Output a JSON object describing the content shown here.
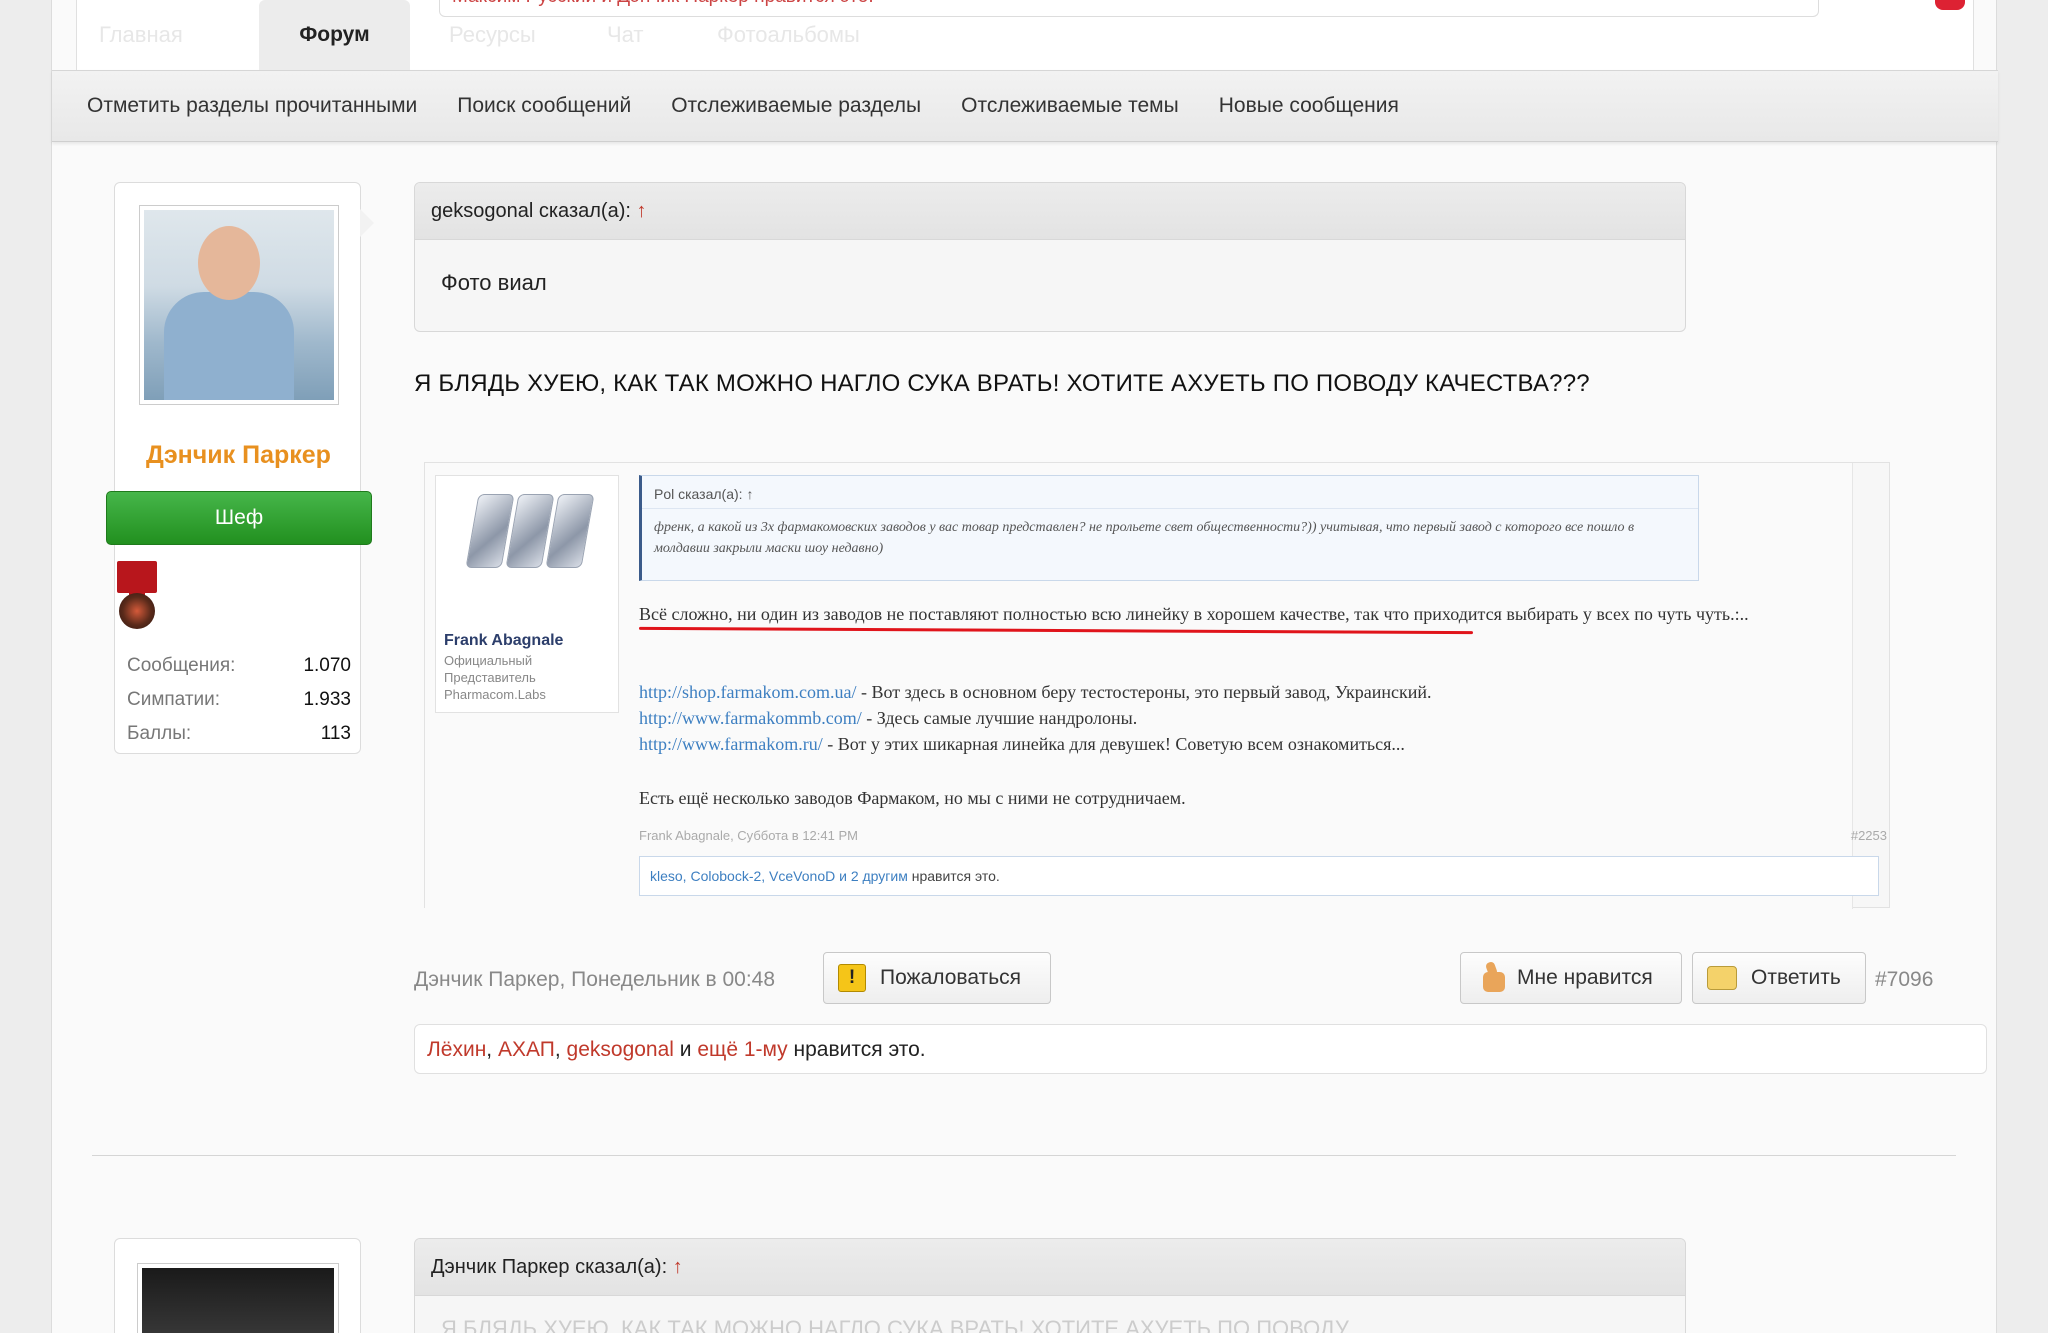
{
  "topnav": {
    "tab_home": "Главная",
    "tab_forum": "Форум",
    "tab_resources": "Ресурсы",
    "tab_chat": "Чат",
    "tab_photos": "Фотоальбомы",
    "top_notice": "Максим Русский и Дэнчик Паркер нравится это."
  },
  "subnav": {
    "items": [
      "Отметить разделы прочитанными",
      "Поиск сообщений",
      "Отслеживаемые разделы",
      "Отслеживаемые темы",
      "Новые сообщения"
    ]
  },
  "post": {
    "author": {
      "name": "Дэнчик Паркер",
      "rank": "Шеф",
      "stats": [
        {
          "label": "Сообщения:",
          "value": "1.070"
        },
        {
          "label": "Симпатии:",
          "value": "1.933"
        },
        {
          "label": "Баллы:",
          "value": "113"
        }
      ]
    },
    "quote": {
      "author_line": "geksogonal сказал(а): ",
      "arrow": "↑",
      "body": "Фото виал"
    },
    "text": "Я БЛЯДЬ ХУЕЮ, КАК ТАК МОЖНО НАГЛО СУКА ВРАТЬ! ХОТИТЕ АХУЕТЬ ПО ПОВОДУ КАЧЕСТВА???",
    "embed": {
      "user_name": "Frank Abagnale",
      "user_role": "Официальный Представитель Pharmacom.Labs",
      "quote_head": "Pol сказал(а): ↑",
      "quote_body": "френк, а какой из 3х фармакомовских заводов у вас товар представлен? не прольете свет общественности?)) учитывая, что первый завод с которого все пошло в молдавии закрыли маски шоу недавно)",
      "line1": "Всё сложно, ни один из заводов не поставляют полностью всю линейку в хорошем качестве, так что приходится выбирать у всех по чуть чуть.:..",
      "link1": "http://shop.farmakom.com.ua/",
      "link1_text": " - Вот здесь в основном беру тестостероны, это первый завод, Украинский.",
      "link2": "http://www.farmakommb.com/",
      "link2_text": " - Здесь самые лучшие нандролоны.",
      "link3": "http://www.farmakom.ru/",
      "link3_text": " - Вот у этих шикарная линейка для девушек! Советую всем ознакомиться...",
      "line_last": "Есть ещё несколько заводов Фармаком, но мы с ними не сотрудничаем.",
      "footer_meta": "Frank Abagnale, Суббота в 12:41 PM",
      "footer_num": "#2253",
      "likes_users": "kleso, Colobock-2, VceVonoD и 2 другим",
      "likes_suffix": " нравится это."
    },
    "meta": "Дэнчик Паркер, Понедельник в 00:48",
    "report_label": "Пожаловаться",
    "like_label": "Мне нравится",
    "reply_label": "Ответить",
    "number": "#7096",
    "likes": {
      "u1": "Лёхин",
      "sep1": ", ",
      "u2": "АХАП",
      "sep2": ", ",
      "u3": "geksogonal",
      "and": " и ",
      "more": "ещё 1-му",
      "suffix": " нравится это."
    }
  },
  "next_post": {
    "quote_author_line": "Дэнчик Паркер сказал(а): ",
    "arrow": "↑",
    "body_preview": "Я БЛЯДЬ ХУЕЮ, КАК ТАК МОЖНО НАГЛО СУКА ВРАТЬ! ХОТИТЕ АХУЕТЬ ПО ПОВОДУ"
  },
  "colors": {
    "accent_red": "#c0392b",
    "username_orange": "#e8901f",
    "rank_green": "#2ea52b",
    "link_blue": "#3d7fc1"
  }
}
